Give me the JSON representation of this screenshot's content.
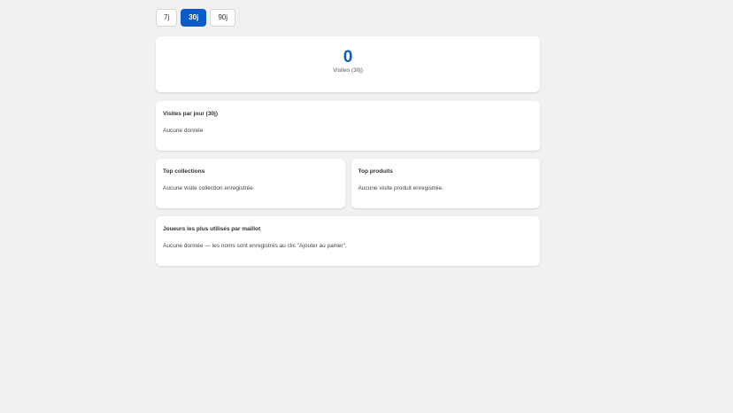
{
  "period_tabs": [
    {
      "label": "7j",
      "active": false
    },
    {
      "label": "30j",
      "active": true
    },
    {
      "label": "90j",
      "active": false
    }
  ],
  "summary": {
    "value": "0",
    "label": "Visites (30j)"
  },
  "daily_visits": {
    "title": "Visites par jour (30j)",
    "empty_text": "Aucune donnée"
  },
  "top_collections": {
    "title": "Top collections",
    "empty_text": "Aucune visite collection enregistrée."
  },
  "top_products": {
    "title": "Top produits",
    "empty_text": "Aucune visite produit enregistrée."
  },
  "top_players": {
    "title": "Joueurs les plus utilisés par maillot",
    "empty_text": "Aucune donnée — les noms sont enregistrés au clic \"Ajouter au panier\"."
  },
  "colors": {
    "accent": "#0b5cc9",
    "background": "#f1f1f1",
    "card": "#ffffff"
  }
}
